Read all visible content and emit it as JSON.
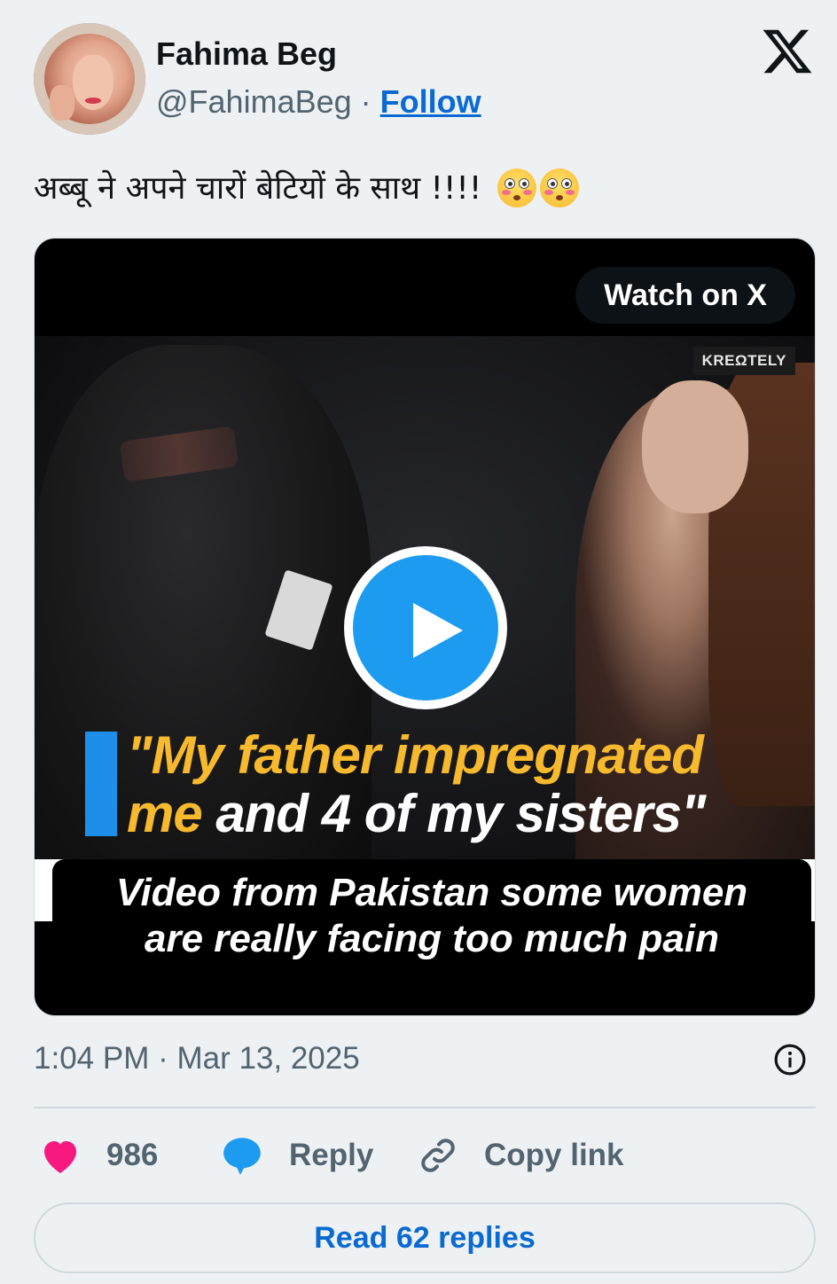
{
  "author": {
    "name": "Fahima Beg",
    "handle": "@FahimaBeg",
    "separator": "·",
    "follow_label": "Follow"
  },
  "tweet": {
    "text": "अब्बू ने अपने चारों बेटियों के साथ !!!!",
    "emoji": [
      "flushed-face",
      "flushed-face"
    ]
  },
  "video": {
    "watch_label": "Watch on X",
    "watermark": "KREΩTELY",
    "quote_line1": "\"My father impregnated",
    "quote_line2_yellow": "me",
    "quote_line2_white": "and 4 of my sisters\"",
    "caption_line1": "Video from Pakistan some women",
    "caption_line2": "are really facing too much pain"
  },
  "meta": {
    "timestamp": "1:04 PM · Mar 13, 2025"
  },
  "actions": {
    "like_count": "986",
    "reply_label": "Reply",
    "copy_label": "Copy link"
  },
  "read_replies_label": "Read 62 replies",
  "colors": {
    "accent": "#0a6ad1",
    "play": "#1d9bf0",
    "like": "#f91880",
    "reply_icon": "#1d9bf0",
    "quote_yellow": "#f7b92d"
  }
}
